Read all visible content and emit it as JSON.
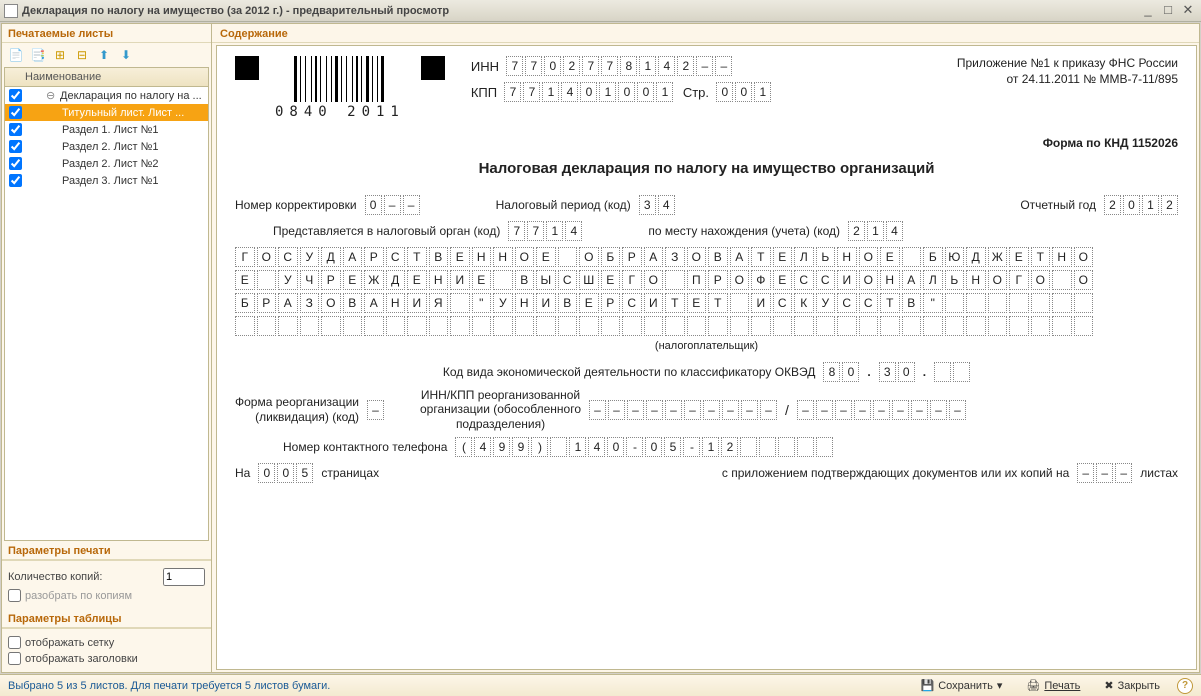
{
  "window": {
    "title": "Декларация по налогу на имущество (за 2012 г.) - предварительный просмотр"
  },
  "sidebar": {
    "header": "Печатаемые листы",
    "tree_header": "Наименование",
    "items": [
      {
        "label": "Декларация по налогу на ...",
        "checked": true,
        "level": 0,
        "expanded": true
      },
      {
        "label": "Титульный лист. Лист ...",
        "checked": true,
        "level": 1,
        "selected": true
      },
      {
        "label": "Раздел 1. Лист №1",
        "checked": true,
        "level": 1
      },
      {
        "label": "Раздел 2. Лист №1",
        "checked": true,
        "level": 1
      },
      {
        "label": "Раздел 2. Лист №2",
        "checked": true,
        "level": 1
      },
      {
        "label": "Раздел 3. Лист №1",
        "checked": true,
        "level": 1
      }
    ],
    "print_params": {
      "header": "Параметры печати",
      "copies_label": "Количество копий:",
      "copies_value": 1,
      "split_label": "разобрать по копиям",
      "split_checked": false
    },
    "table_params": {
      "header": "Параметры таблицы",
      "grid_label": "отображать сетку",
      "grid_checked": false,
      "headers_label": "отображать заголовки",
      "headers_checked": false
    }
  },
  "content_header": "Содержание",
  "doc": {
    "barcode_text": "0840 2011",
    "inn_label": "ИНН",
    "inn": [
      "7",
      "7",
      "0",
      "2",
      "7",
      "7",
      "8",
      "1",
      "4",
      "2",
      "–",
      "–"
    ],
    "kpp_label": "КПП",
    "kpp": [
      "7",
      "7",
      "1",
      "4",
      "0",
      "1",
      "0",
      "0",
      "1"
    ],
    "page_label": "Стр.",
    "page": [
      "0",
      "0",
      "1"
    ],
    "attach_line1": "Приложение №1 к приказу ФНС России",
    "attach_line2": "от 24.11.2011 № ММВ-7-11/895",
    "form_code": "Форма по КНД 1152026",
    "title": "Налоговая декларация по налогу на имущество организаций",
    "correction_label": "Номер корректировки",
    "correction": [
      "0",
      "–",
      "–"
    ],
    "tax_period_label": "Налоговый период  (код)",
    "tax_period": [
      "3",
      "4"
    ],
    "year_label": "Отчетный год",
    "year": [
      "2",
      "0",
      "1",
      "2"
    ],
    "submit_to_label": "Представляется в налоговый орган  (код)",
    "submit_to": [
      "7",
      "7",
      "1",
      "4"
    ],
    "location_label": "по месту нахождения (учета)  (код)",
    "location": [
      "2",
      "1",
      "4"
    ],
    "name_lines": [
      "ГОСУДАРСТВЕННОЕ ОБРАЗОВАТЕЛЬНОЕ БЮДЖЕТНО",
      "Е УЧРЕЖДЕНИЕ ВЫСШЕГО ПРОФЕССИОНАЛЬНОГО О",
      "БРАЗОВАНИЯ \"УНИВЕРСИТЕТ ИСКУССТВ\"",
      ""
    ],
    "name_cols": 40,
    "taxpayer_sub": "(налогоплательщик)",
    "okved_label": "Код вида экономической деятельности по классификатору ОКВЭД",
    "okved_1": [
      "8",
      "0"
    ],
    "okved_2": [
      "3",
      "0"
    ],
    "okved_3": [
      "",
      ""
    ],
    "reorg_label_1": "Форма реорганизации",
    "reorg_label_2": "(ликвидация) (код)",
    "reorg_code": [
      "–"
    ],
    "reorg_inn_label_1": "ИНН/КПП реорганизованной",
    "reorg_inn_label_2": "организации (обособленного",
    "reorg_inn_label_3": "подразделения)",
    "reorg_inn": [
      "–",
      "–",
      "–",
      "–",
      "–",
      "–",
      "–",
      "–",
      "–",
      "–"
    ],
    "reorg_kpp": [
      "–",
      "–",
      "–",
      "–",
      "–",
      "–",
      "–",
      "–",
      "–"
    ],
    "phone_label": "Номер контактного телефона",
    "phone": [
      "(",
      "4",
      "9",
      "9",
      ")",
      "",
      "1",
      "4",
      "0",
      "-",
      "0",
      "5",
      "-",
      "1",
      "2",
      "",
      "",
      "",
      "",
      ""
    ],
    "pages_prefix": "На",
    "pages_val": [
      "0",
      "0",
      "5"
    ],
    "pages_suffix": "страницах",
    "attachments_text": "с приложением подтверждающих документов или их копий на",
    "attachments_val": [
      "–",
      "–",
      "–"
    ],
    "attachments_suffix": "листах"
  },
  "status": {
    "selected": "Выбрано 5 из 5 листов. Для печати требуется 5 листов бумаги.",
    "save": "Сохранить",
    "print": "Печать",
    "close": "Закрыть"
  }
}
